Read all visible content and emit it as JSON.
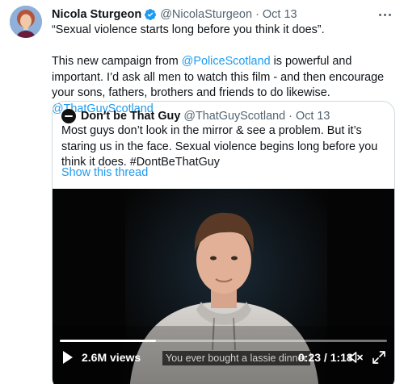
{
  "author": {
    "name": "Nicola Sturgeon",
    "handle": "@NicolaSturgeon",
    "separator": "·",
    "date": "Oct 13"
  },
  "tweet": {
    "line1": "“Sexual violence starts long before you think it does”.",
    "body_pre": "This new campaign from ",
    "mention1": "@PoliceScotland",
    "body_mid": " is powerful and important.  I’d ask all men to watch this film - and then encourage your sons, fathers, brothers and friends to do likewise. ",
    "mention2": "@ThatGuyScotland"
  },
  "quote": {
    "name": "Don't be That Guy",
    "handle": "@ThatGuyScotland",
    "separator": "·",
    "date": "Oct 13",
    "text": "Most guys don’t look in the mirror & see a problem. But it’s staring us in the face. Sexual violence begins long before you think it does. #DontBeThatGuy",
    "show_thread": "Show this thread"
  },
  "video": {
    "views": "2.6M views",
    "caption": "You ever bought a lassie dinner",
    "time": "0:23 / 1:18",
    "progress": 0.295
  },
  "icons": {
    "verified": "verified-badge-icon",
    "more": "more-options-icon",
    "play": "play-icon",
    "volume": "volume-muted-icon",
    "expand": "fullscreen-icon"
  },
  "colors": {
    "accent": "#1d9bf0",
    "text": "#0f1419",
    "muted": "#536471",
    "border": "#cfd9de"
  }
}
